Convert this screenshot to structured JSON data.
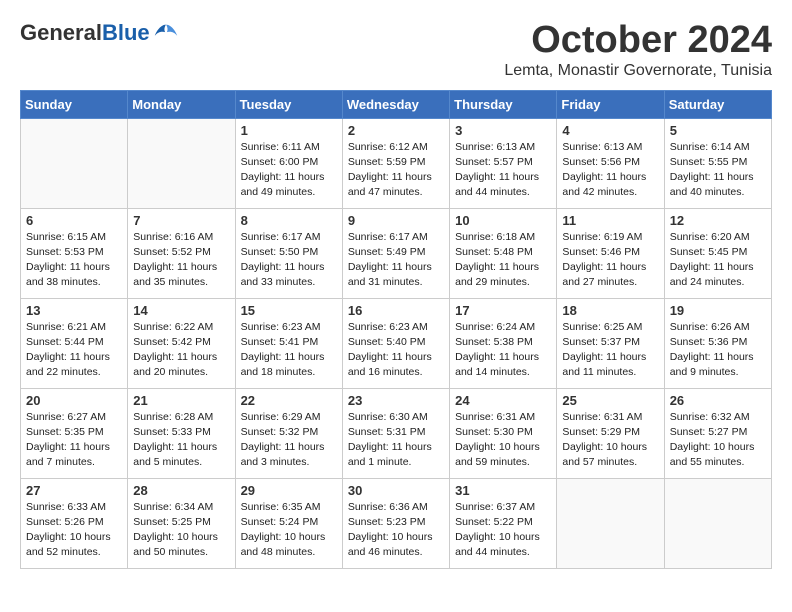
{
  "header": {
    "logo_general": "General",
    "logo_blue": "Blue",
    "month": "October 2024",
    "location": "Lemta, Monastir Governorate, Tunisia"
  },
  "weekdays": [
    "Sunday",
    "Monday",
    "Tuesday",
    "Wednesday",
    "Thursday",
    "Friday",
    "Saturday"
  ],
  "weeks": [
    [
      {
        "day": "",
        "sunrise": "",
        "sunset": "",
        "daylight": ""
      },
      {
        "day": "",
        "sunrise": "",
        "sunset": "",
        "daylight": ""
      },
      {
        "day": "1",
        "sunrise": "Sunrise: 6:11 AM",
        "sunset": "Sunset: 6:00 PM",
        "daylight": "Daylight: 11 hours and 49 minutes."
      },
      {
        "day": "2",
        "sunrise": "Sunrise: 6:12 AM",
        "sunset": "Sunset: 5:59 PM",
        "daylight": "Daylight: 11 hours and 47 minutes."
      },
      {
        "day": "3",
        "sunrise": "Sunrise: 6:13 AM",
        "sunset": "Sunset: 5:57 PM",
        "daylight": "Daylight: 11 hours and 44 minutes."
      },
      {
        "day": "4",
        "sunrise": "Sunrise: 6:13 AM",
        "sunset": "Sunset: 5:56 PM",
        "daylight": "Daylight: 11 hours and 42 minutes."
      },
      {
        "day": "5",
        "sunrise": "Sunrise: 6:14 AM",
        "sunset": "Sunset: 5:55 PM",
        "daylight": "Daylight: 11 hours and 40 minutes."
      }
    ],
    [
      {
        "day": "6",
        "sunrise": "Sunrise: 6:15 AM",
        "sunset": "Sunset: 5:53 PM",
        "daylight": "Daylight: 11 hours and 38 minutes."
      },
      {
        "day": "7",
        "sunrise": "Sunrise: 6:16 AM",
        "sunset": "Sunset: 5:52 PM",
        "daylight": "Daylight: 11 hours and 35 minutes."
      },
      {
        "day": "8",
        "sunrise": "Sunrise: 6:17 AM",
        "sunset": "Sunset: 5:50 PM",
        "daylight": "Daylight: 11 hours and 33 minutes."
      },
      {
        "day": "9",
        "sunrise": "Sunrise: 6:17 AM",
        "sunset": "Sunset: 5:49 PM",
        "daylight": "Daylight: 11 hours and 31 minutes."
      },
      {
        "day": "10",
        "sunrise": "Sunrise: 6:18 AM",
        "sunset": "Sunset: 5:48 PM",
        "daylight": "Daylight: 11 hours and 29 minutes."
      },
      {
        "day": "11",
        "sunrise": "Sunrise: 6:19 AM",
        "sunset": "Sunset: 5:46 PM",
        "daylight": "Daylight: 11 hours and 27 minutes."
      },
      {
        "day": "12",
        "sunrise": "Sunrise: 6:20 AM",
        "sunset": "Sunset: 5:45 PM",
        "daylight": "Daylight: 11 hours and 24 minutes."
      }
    ],
    [
      {
        "day": "13",
        "sunrise": "Sunrise: 6:21 AM",
        "sunset": "Sunset: 5:44 PM",
        "daylight": "Daylight: 11 hours and 22 minutes."
      },
      {
        "day": "14",
        "sunrise": "Sunrise: 6:22 AM",
        "sunset": "Sunset: 5:42 PM",
        "daylight": "Daylight: 11 hours and 20 minutes."
      },
      {
        "day": "15",
        "sunrise": "Sunrise: 6:23 AM",
        "sunset": "Sunset: 5:41 PM",
        "daylight": "Daylight: 11 hours and 18 minutes."
      },
      {
        "day": "16",
        "sunrise": "Sunrise: 6:23 AM",
        "sunset": "Sunset: 5:40 PM",
        "daylight": "Daylight: 11 hours and 16 minutes."
      },
      {
        "day": "17",
        "sunrise": "Sunrise: 6:24 AM",
        "sunset": "Sunset: 5:38 PM",
        "daylight": "Daylight: 11 hours and 14 minutes."
      },
      {
        "day": "18",
        "sunrise": "Sunrise: 6:25 AM",
        "sunset": "Sunset: 5:37 PM",
        "daylight": "Daylight: 11 hours and 11 minutes."
      },
      {
        "day": "19",
        "sunrise": "Sunrise: 6:26 AM",
        "sunset": "Sunset: 5:36 PM",
        "daylight": "Daylight: 11 hours and 9 minutes."
      }
    ],
    [
      {
        "day": "20",
        "sunrise": "Sunrise: 6:27 AM",
        "sunset": "Sunset: 5:35 PM",
        "daylight": "Daylight: 11 hours and 7 minutes."
      },
      {
        "day": "21",
        "sunrise": "Sunrise: 6:28 AM",
        "sunset": "Sunset: 5:33 PM",
        "daylight": "Daylight: 11 hours and 5 minutes."
      },
      {
        "day": "22",
        "sunrise": "Sunrise: 6:29 AM",
        "sunset": "Sunset: 5:32 PM",
        "daylight": "Daylight: 11 hours and 3 minutes."
      },
      {
        "day": "23",
        "sunrise": "Sunrise: 6:30 AM",
        "sunset": "Sunset: 5:31 PM",
        "daylight": "Daylight: 11 hours and 1 minute."
      },
      {
        "day": "24",
        "sunrise": "Sunrise: 6:31 AM",
        "sunset": "Sunset: 5:30 PM",
        "daylight": "Daylight: 10 hours and 59 minutes."
      },
      {
        "day": "25",
        "sunrise": "Sunrise: 6:31 AM",
        "sunset": "Sunset: 5:29 PM",
        "daylight": "Daylight: 10 hours and 57 minutes."
      },
      {
        "day": "26",
        "sunrise": "Sunrise: 6:32 AM",
        "sunset": "Sunset: 5:27 PM",
        "daylight": "Daylight: 10 hours and 55 minutes."
      }
    ],
    [
      {
        "day": "27",
        "sunrise": "Sunrise: 6:33 AM",
        "sunset": "Sunset: 5:26 PM",
        "daylight": "Daylight: 10 hours and 52 minutes."
      },
      {
        "day": "28",
        "sunrise": "Sunrise: 6:34 AM",
        "sunset": "Sunset: 5:25 PM",
        "daylight": "Daylight: 10 hours and 50 minutes."
      },
      {
        "day": "29",
        "sunrise": "Sunrise: 6:35 AM",
        "sunset": "Sunset: 5:24 PM",
        "daylight": "Daylight: 10 hours and 48 minutes."
      },
      {
        "day": "30",
        "sunrise": "Sunrise: 6:36 AM",
        "sunset": "Sunset: 5:23 PM",
        "daylight": "Daylight: 10 hours and 46 minutes."
      },
      {
        "day": "31",
        "sunrise": "Sunrise: 6:37 AM",
        "sunset": "Sunset: 5:22 PM",
        "daylight": "Daylight: 10 hours and 44 minutes."
      },
      {
        "day": "",
        "sunrise": "",
        "sunset": "",
        "daylight": ""
      },
      {
        "day": "",
        "sunrise": "",
        "sunset": "",
        "daylight": ""
      }
    ]
  ]
}
